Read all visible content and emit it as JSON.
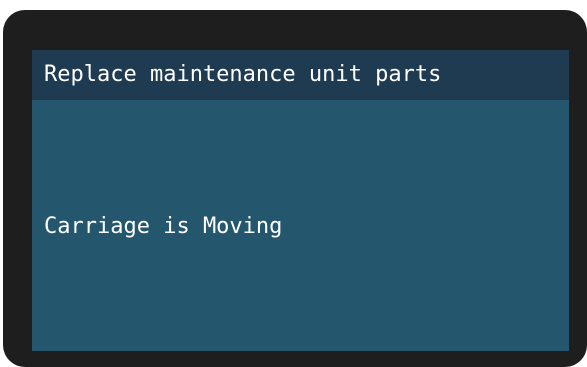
{
  "screen": {
    "title": "Replace maintenance unit parts",
    "status": "Carriage is Moving"
  },
  "colors": {
    "bezel": "#1e1e1e",
    "screen_background": "#24566d",
    "title_bar_background": "#1f3b52",
    "text": "#ffffff"
  }
}
